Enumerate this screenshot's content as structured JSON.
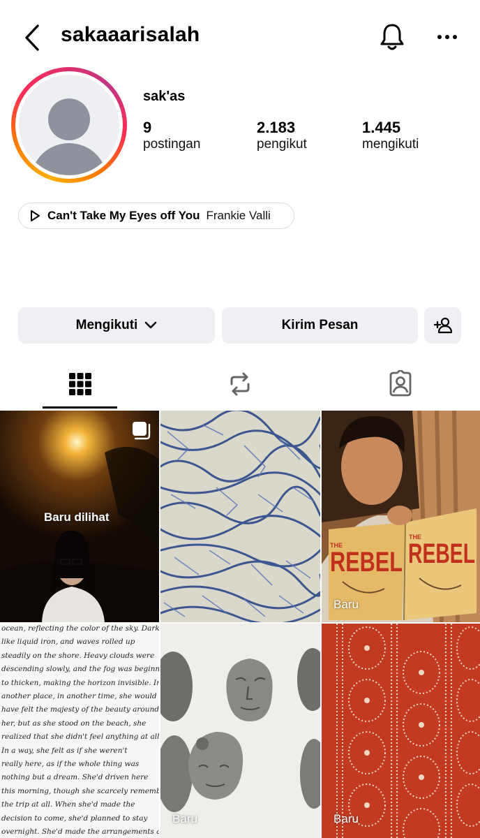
{
  "header": {
    "username": "sakaaarisalah",
    "icons": {
      "back": "chevron-left-icon",
      "notifications": "bell-icon",
      "more": "more-horizontal-icon"
    }
  },
  "profile": {
    "display_name": "sak'as",
    "stats": [
      {
        "value": "9",
        "label": "postingan"
      },
      {
        "value": "2.183",
        "label": "pengikut"
      },
      {
        "value": "1.445",
        "label": "mengikuti"
      }
    ],
    "avatar_icon": "default-avatar-icon"
  },
  "music": {
    "song": "Can't Take My Eyes off You",
    "artist": "Frankie Valli",
    "icon": "play-icon"
  },
  "actions": {
    "follow_label": "Mengikuti",
    "message_label": "Kirim Pesan",
    "add_user_icon": "add-user-icon"
  },
  "tabs": [
    {
      "icon": "grid-icon",
      "active": true
    },
    {
      "icon": "repost-icon",
      "active": false
    },
    {
      "icon": "tagged-icon",
      "active": false
    }
  ],
  "grid": {
    "items": [
      {
        "label": "Baru dilihat",
        "multi": true
      },
      {
        "label": ""
      },
      {
        "label": "Baru"
      },
      {
        "label": ""
      },
      {
        "label": "Baru"
      },
      {
        "label": "Baru"
      }
    ],
    "paper_text": [
      "ocean, reflecting the color of the sky. Dark",
      "like liquid iron, and waves rolled up",
      "steadily on the shore. Heavy clouds were",
      "descending slowly, and the fog was beginning",
      "to thicken, making the horizon invisible. In",
      "another place, in another time, she would",
      "have felt the majesty of the beauty around",
      "her, but as she stood on the beach, she",
      "realized that she didn't feel anything at all.",
      "In a way, she felt as if she weren't",
      "really here, as if the whole thing was",
      "nothing but a dream. She'd driven here",
      "this morning, though she scarcely remembered",
      "the trip at all. When she'd made the",
      "decision to come, she'd planned to stay",
      "overnight. She'd made the arrangements a"
    ],
    "book_title": "REBEL",
    "book_publisher": "THE"
  },
  "colors": {
    "button_bg": "#eff0f3",
    "ring_gradient": [
      "#ffb000",
      "#ff2d55",
      "#c13584"
    ],
    "batik_red": "#c43a22"
  }
}
